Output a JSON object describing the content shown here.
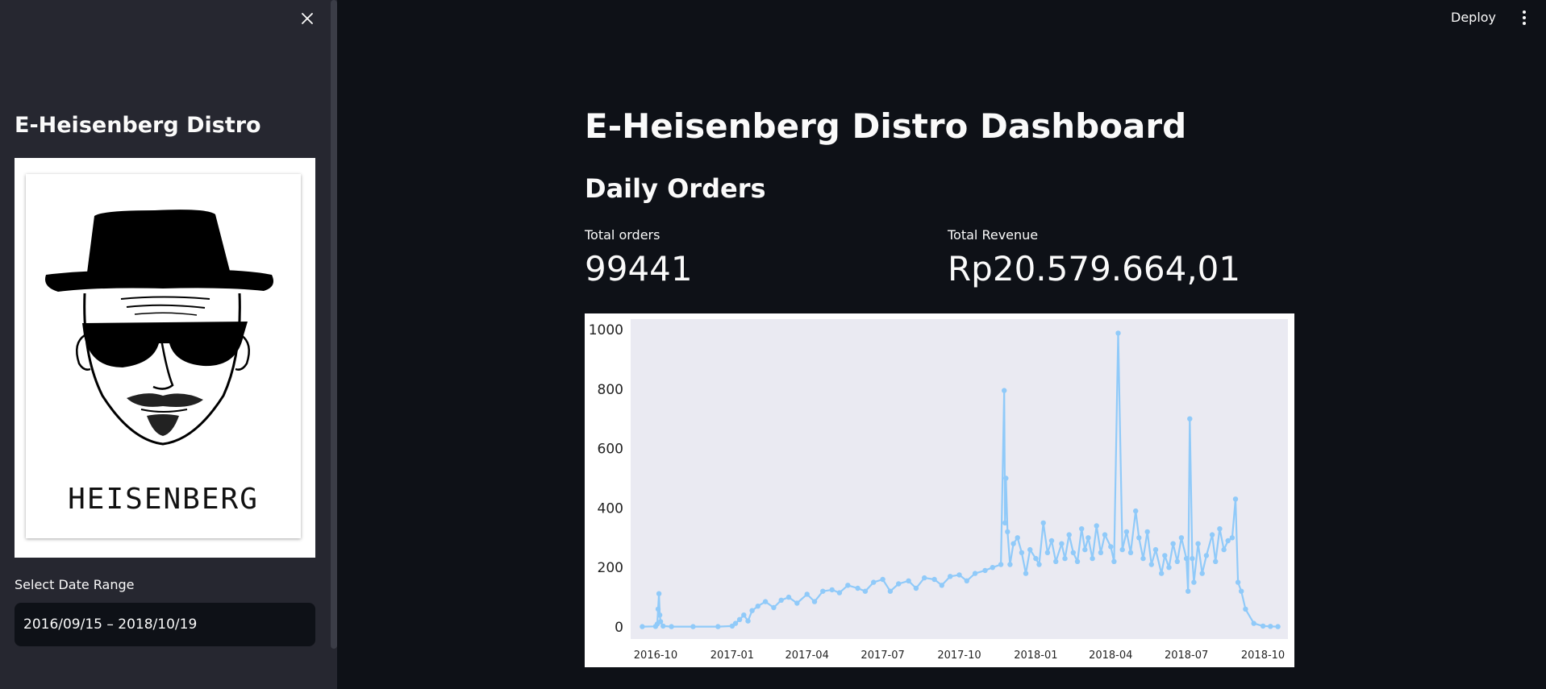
{
  "sidebar": {
    "title": "E-Heisenberg Distro",
    "logo_text": "HEISENBERG",
    "logo_icon": "heisenberg-portrait",
    "close_icon": "close-icon",
    "date_filter": {
      "label": "Select Date Range",
      "value": "2016/09/15 – 2018/10/19"
    }
  },
  "header": {
    "deploy_label": "Deploy",
    "menu_icon": "vertical-ellipsis-icon"
  },
  "main": {
    "title": "E-Heisenberg Distro Dashboard",
    "subtitle": "Daily Orders",
    "metrics": [
      {
        "label": "Total orders",
        "value": "99441"
      },
      {
        "label": "Total Revenue",
        "value": "Rp20.579.664,01"
      }
    ]
  },
  "colors": {
    "background": "#0e1117",
    "sidebar": "#262730",
    "plot_background": "#eaeaf2",
    "line": "#90caf9"
  },
  "chart_data": {
    "type": "line",
    "title": "",
    "xlabel": "",
    "ylabel": "",
    "grid": false,
    "markers": true,
    "ylim": [
      0,
      1000
    ],
    "xlim": [
      "2016-09-01",
      "2018-10-31"
    ],
    "yticks": [
      0,
      200,
      400,
      600,
      800,
      1000
    ],
    "xticks": [
      "2016-10",
      "2017-01",
      "2017-04",
      "2017-07",
      "2017-10",
      "2018-01",
      "2018-04",
      "2018-07",
      "2018-10"
    ],
    "series": [
      {
        "x": [
          "2016-09-15",
          "2016-10-01",
          "2016-10-03",
          "2016-10-04",
          "2016-10-05",
          "2016-10-06",
          "2016-10-07",
          "2016-10-10",
          "2016-10-20",
          "2016-11-15",
          "2016-12-15",
          "2017-01-01",
          "2017-01-05",
          "2017-01-10",
          "2017-01-15",
          "2017-01-20",
          "2017-01-25",
          "2017-02-01",
          "2017-02-10",
          "2017-02-20",
          "2017-03-01",
          "2017-03-10",
          "2017-03-20",
          "2017-04-01",
          "2017-04-10",
          "2017-04-20",
          "2017-05-01",
          "2017-05-10",
          "2017-05-20",
          "2017-06-01",
          "2017-06-10",
          "2017-06-20",
          "2017-07-01",
          "2017-07-10",
          "2017-07-20",
          "2017-08-01",
          "2017-08-10",
          "2017-08-20",
          "2017-09-01",
          "2017-09-10",
          "2017-09-20",
          "2017-10-01",
          "2017-10-10",
          "2017-10-20",
          "2017-11-01",
          "2017-11-10",
          "2017-11-20",
          "2017-11-24",
          "2017-11-25",
          "2017-11-26",
          "2017-11-28",
          "2017-12-01",
          "2017-12-05",
          "2017-12-10",
          "2017-12-15",
          "2017-12-20",
          "2017-12-25",
          "2018-01-01",
          "2018-01-05",
          "2018-01-10",
          "2018-01-15",
          "2018-01-20",
          "2018-01-25",
          "2018-02-01",
          "2018-02-05",
          "2018-02-10",
          "2018-02-15",
          "2018-02-20",
          "2018-02-25",
          "2018-03-01",
          "2018-03-05",
          "2018-03-10",
          "2018-03-15",
          "2018-03-20",
          "2018-03-25",
          "2018-04-01",
          "2018-04-05",
          "2018-04-10",
          "2018-04-15",
          "2018-04-20",
          "2018-04-25",
          "2018-05-01",
          "2018-05-05",
          "2018-05-10",
          "2018-05-15",
          "2018-05-20",
          "2018-05-25",
          "2018-06-01",
          "2018-06-05",
          "2018-06-10",
          "2018-06-15",
          "2018-06-20",
          "2018-06-25",
          "2018-07-01",
          "2018-07-03",
          "2018-07-05",
          "2018-07-08",
          "2018-07-10",
          "2018-07-15",
          "2018-07-20",
          "2018-07-25",
          "2018-08-01",
          "2018-08-05",
          "2018-08-10",
          "2018-08-15",
          "2018-08-20",
          "2018-08-25",
          "2018-08-29",
          "2018-09-01",
          "2018-09-05",
          "2018-09-10",
          "2018-09-20",
          "2018-10-01",
          "2018-10-10",
          "2018-10-19"
        ],
        "y": [
          1,
          2,
          10,
          60,
          112,
          40,
          18,
          3,
          1,
          1,
          1,
          3,
          12,
          25,
          40,
          20,
          55,
          70,
          85,
          65,
          90,
          100,
          80,
          110,
          85,
          120,
          125,
          115,
          140,
          130,
          120,
          150,
          160,
          120,
          145,
          155,
          130,
          165,
          160,
          140,
          170,
          175,
          155,
          180,
          190,
          200,
          210,
          795,
          350,
          500,
          320,
          210,
          280,
          300,
          250,
          180,
          260,
          230,
          210,
          350,
          250,
          290,
          220,
          280,
          230,
          310,
          250,
          220,
          330,
          260,
          300,
          230,
          340,
          250,
          310,
          270,
          220,
          988,
          260,
          320,
          250,
          390,
          300,
          230,
          320,
          210,
          260,
          180,
          240,
          200,
          280,
          220,
          300,
          230,
          120,
          700,
          230,
          150,
          280,
          180,
          240,
          310,
          220,
          330,
          260,
          290,
          300,
          430,
          150,
          120,
          60,
          12,
          3,
          2,
          1
        ]
      }
    ]
  }
}
